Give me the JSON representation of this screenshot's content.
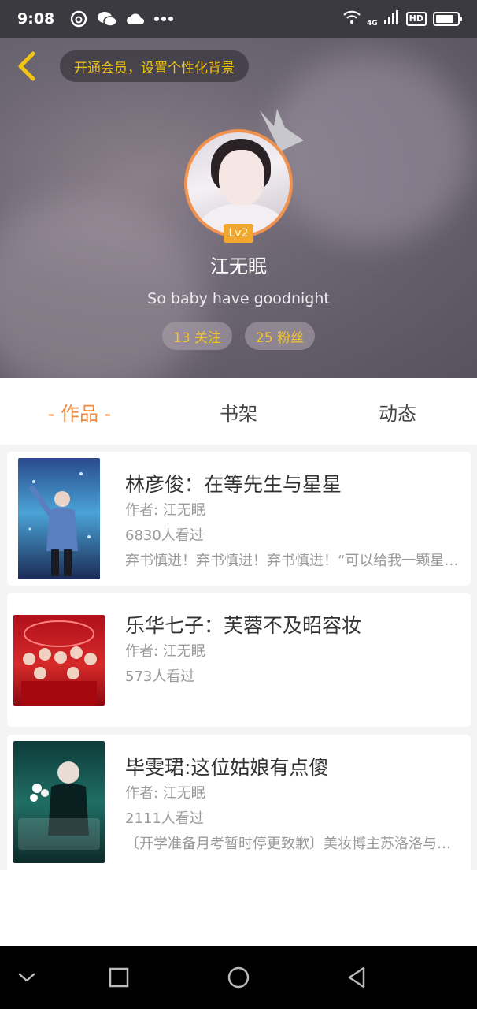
{
  "status_bar": {
    "time": "9:08",
    "network": "4G",
    "hd": "HD"
  },
  "header": {
    "vip_prompt": "开通会员，设置个性化背景",
    "level": "Lv2",
    "username": "江无眠",
    "bio": "So baby have goodnight",
    "following": "13 关注",
    "followers": "25 粉丝"
  },
  "tabs": [
    {
      "label": "- 作品 -",
      "active": true
    },
    {
      "label": "书架",
      "active": false
    },
    {
      "label": "动态",
      "active": false
    }
  ],
  "works": [
    {
      "title": "林彦俊：在等先生与星星",
      "author": "作者: 江无眠",
      "views": "6830人看过",
      "desc": "弃书慎进！弃书慎进！弃书慎进！“可以给我一颗星星吗？”"
    },
    {
      "title": "乐华七子：芙蓉不及昭容妆",
      "author": "作者: 江无眠",
      "views": "573人看过",
      "desc": ""
    },
    {
      "title": "毕雯珺:这位姑娘有点傻",
      "author": "作者: 江无眠",
      "views": "2111人看过",
      "desc": "〔开学准备月考暂时停更致歉〕美妆博主苏洛洛与她的故事"
    }
  ],
  "colors": {
    "accent": "#f2893b",
    "gold": "#f4c32a",
    "avatar_ring": "#f0914d"
  }
}
